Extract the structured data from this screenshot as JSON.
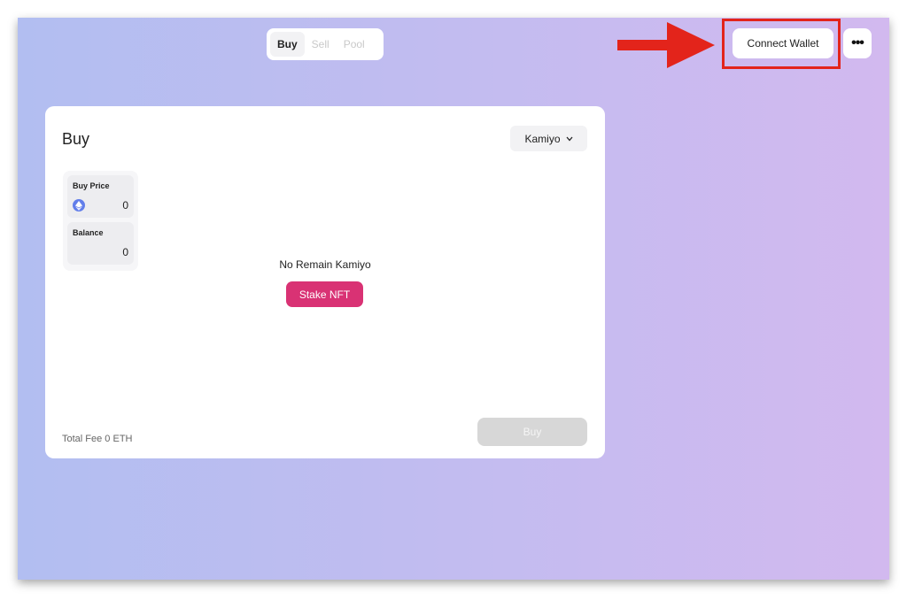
{
  "header": {
    "tabs": [
      {
        "label": "Buy"
      },
      {
        "label": "Sell"
      },
      {
        "label": "Pool"
      }
    ],
    "connect_wallet_label": "Connect Wallet",
    "more_label": "•••",
    "accent_arrow_color": "#e3241b"
  },
  "card": {
    "title": "Buy",
    "collection_select": "Kamiyo",
    "buy_price": {
      "label": "Buy Price",
      "value": "0",
      "icon": "eth-icon"
    },
    "balance": {
      "label": "Balance",
      "value": "0"
    },
    "empty_message": "No Remain Kamiyo",
    "stake_button_label": "Stake NFT",
    "total_fee": "Total Fee 0 ETH",
    "buy_button_label": "Buy"
  },
  "colors": {
    "stake_button": "#d93274",
    "eth_icon": "#627eea",
    "disabled_button": "#d7d7d7"
  }
}
